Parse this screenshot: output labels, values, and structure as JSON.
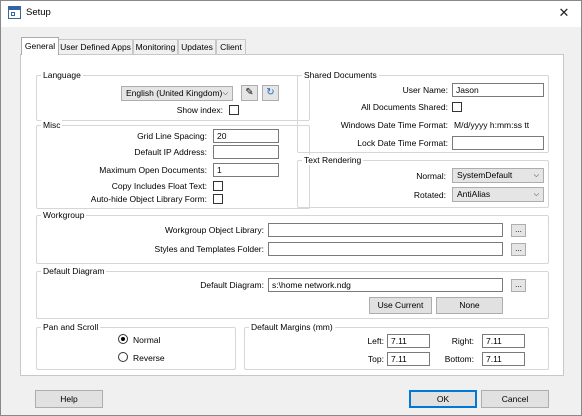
{
  "window": {
    "title": "Setup",
    "close_glyph": "✕"
  },
  "tabs": [
    "General",
    "User Defined Apps",
    "Monitoring",
    "Updates",
    "Client"
  ],
  "language": {
    "group_label": "Language",
    "selected": "English (United Kingdom)",
    "show_index_label": "Show index:",
    "show_index_checked": false
  },
  "misc": {
    "group_label": "Misc",
    "grid_line_spacing_label": "Grid Line Spacing:",
    "grid_line_spacing_value": "20",
    "default_ip_label": "Default IP Address:",
    "default_ip_value": "",
    "max_open_docs_label": "Maximum Open Documents:",
    "max_open_docs_value": "1",
    "copy_float_text_label": "Copy Includes Float Text:",
    "auto_hide_label": "Auto-hide Object Library Form:"
  },
  "shared": {
    "group_label": "Shared Documents",
    "user_name_label": "User Name:",
    "user_name_value": "Jason",
    "all_shared_label": "All Documents Shared:",
    "win_date_label": "Windows Date Time Format:",
    "win_date_value": "M/d/yyyy h:mm:ss tt",
    "lock_date_label": "Lock Date Time Format:",
    "lock_date_value": ""
  },
  "text_rendering": {
    "group_label": "Text Rendering",
    "normal_label": "Normal:",
    "normal_value": "SystemDefault",
    "rotated_label": "Rotated:",
    "rotated_value": "AntiAlias"
  },
  "workgroup": {
    "group_label": "Workgroup",
    "object_library_label": "Workgroup Object Library:",
    "object_library_value": "",
    "styles_folder_label": "Styles and Templates Folder:",
    "styles_folder_value": ""
  },
  "default_diagram": {
    "group_label": "Default Diagram",
    "label": "Default Diagram:",
    "value": "s:\\home network.ndg",
    "use_current": "Use Current",
    "none": "None"
  },
  "browse_glyph": "...",
  "pan_scroll": {
    "group_label": "Pan and Scroll",
    "options": [
      "Normal",
      "Reverse"
    ],
    "selected": "Normal"
  },
  "margins": {
    "group_label": "Default Margins (mm)",
    "left_label": "Left:",
    "left_value": "7.11",
    "right_label": "Right:",
    "right_value": "7.11",
    "top_label": "Top:",
    "top_value": "7.11",
    "bottom_label": "Bottom:",
    "bottom_value": "7.11"
  },
  "footer": {
    "help": "Help",
    "ok": "OK",
    "cancel": "Cancel"
  },
  "colors": {
    "accent": "#0078d7",
    "refresh_icon": "#1e64c8"
  }
}
